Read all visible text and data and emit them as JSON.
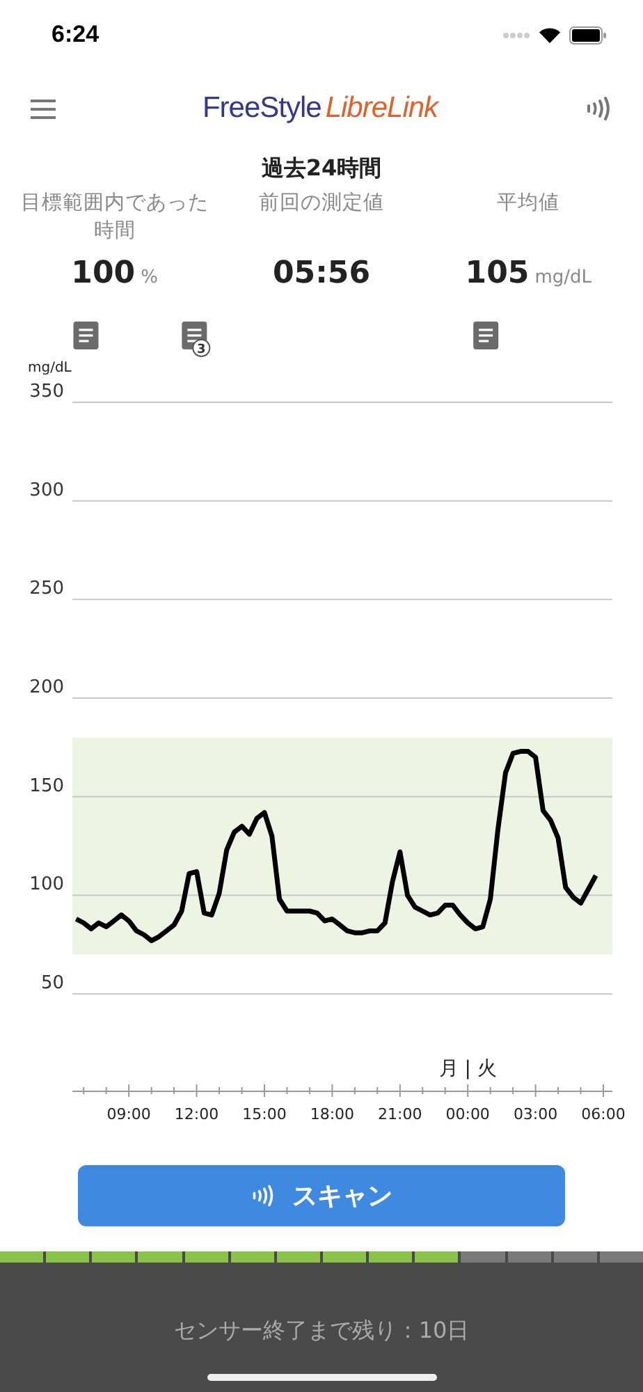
{
  "status_bar": {
    "time": "6:24"
  },
  "header": {
    "logo": {
      "part1": "FreeStyle",
      "part2": "LibreLink"
    }
  },
  "title": "過去24時間",
  "stats": [
    {
      "label": "目標範囲内であった時間",
      "value": "100",
      "unit": "%"
    },
    {
      "label": "前回の測定値",
      "value": "05:56"
    },
    {
      "label": "平均値",
      "value": "105",
      "unit": "mg/dL"
    }
  ],
  "chart_data": {
    "type": "line",
    "grid": true,
    "ylabel": "mg/dL",
    "ylim": [
      50,
      350
    ],
    "yticks": [
      50,
      100,
      150,
      200,
      250,
      300,
      350
    ],
    "categories": [
      null,
      null,
      null,
      null,
      null,
      null,
      null,
      "09:00",
      null,
      null,
      null,
      null,
      null,
      null,
      null,
      null,
      "12:00",
      null,
      null,
      null,
      null,
      null,
      null,
      null,
      null,
      "15:00",
      null,
      null,
      null,
      null,
      null,
      null,
      null,
      null,
      "18:00",
      null,
      null,
      null,
      null,
      null,
      null,
      null,
      null,
      "21:00",
      null,
      null,
      null,
      null,
      null,
      null,
      null,
      null,
      "00:00",
      null,
      null,
      null,
      null,
      null,
      null,
      null,
      null,
      "03:00",
      null,
      null,
      null,
      null,
      null,
      null,
      null,
      null,
      "06:00"
    ],
    "series": [
      {
        "color": "#000000",
        "values": [
          88,
          86,
          83,
          86,
          84,
          87,
          90,
          87,
          82,
          80,
          77,
          79,
          82,
          85,
          92,
          111,
          112,
          91,
          90,
          101,
          123,
          132,
          135,
          131,
          139,
          142,
          130,
          98,
          92,
          92,
          92,
          92,
          91,
          87,
          88,
          85,
          82,
          81,
          81,
          82,
          82,
          86,
          107,
          122,
          100,
          94,
          92,
          90,
          91,
          95,
          95,
          90,
          86,
          83,
          84,
          98,
          133,
          162,
          172,
          173,
          173,
          170,
          143,
          138,
          129,
          104,
          99,
          96,
          103,
          110,
          null
        ]
      }
    ],
    "bands": [
      {
        "axis": "y",
        "from": 70,
        "to": 180,
        "color": "#edf4e4"
      }
    ],
    "annotations": [
      "月 | 火"
    ]
  },
  "notes": [
    {
      "kind": "note"
    },
    {
      "kind": "note",
      "count": "3"
    },
    {
      "kind": "note"
    }
  ],
  "scan_button": {
    "label": "スキャン"
  },
  "sensor": {
    "level": 0.714,
    "remaining": "センサー終了まで残り：10日"
  }
}
